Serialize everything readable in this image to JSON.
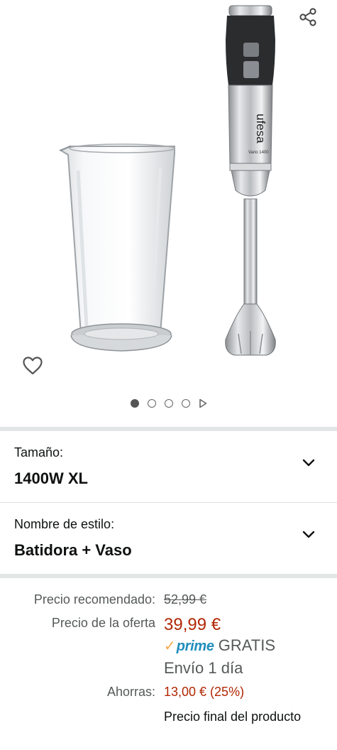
{
  "product": {
    "brand_mark": "ufesa",
    "model_mark": "Vario 1400",
    "image_count": 4,
    "active_image": 1
  },
  "icons": {
    "share": "share-icon",
    "wishlist": "heart-outline-icon",
    "next": "play-triangle-icon",
    "expand": "chevron-down-icon"
  },
  "variations": [
    {
      "label": "Tamaño:",
      "value": "1400W XL"
    },
    {
      "label": "Nombre de estilo:",
      "value": "Batidora + Vaso"
    }
  ],
  "pricing": {
    "recommended_label": "Precio recomendado:",
    "recommended_value": "52,99 €",
    "offer_label": "Precio de la oferta",
    "offer_value": "39,99 €",
    "prime_text": "prime",
    "shipping_free": "GRATIS",
    "delivery": "Envío 1 día",
    "savings_label": "Ahorras:",
    "savings_value": "13,00 € (25%)",
    "final_note": "Precio final del producto"
  },
  "colors": {
    "price_red": "#b12704",
    "prime_blue": "#1f8ebc",
    "prime_orange": "#f3a847",
    "divider": "#e3e6e6"
  }
}
